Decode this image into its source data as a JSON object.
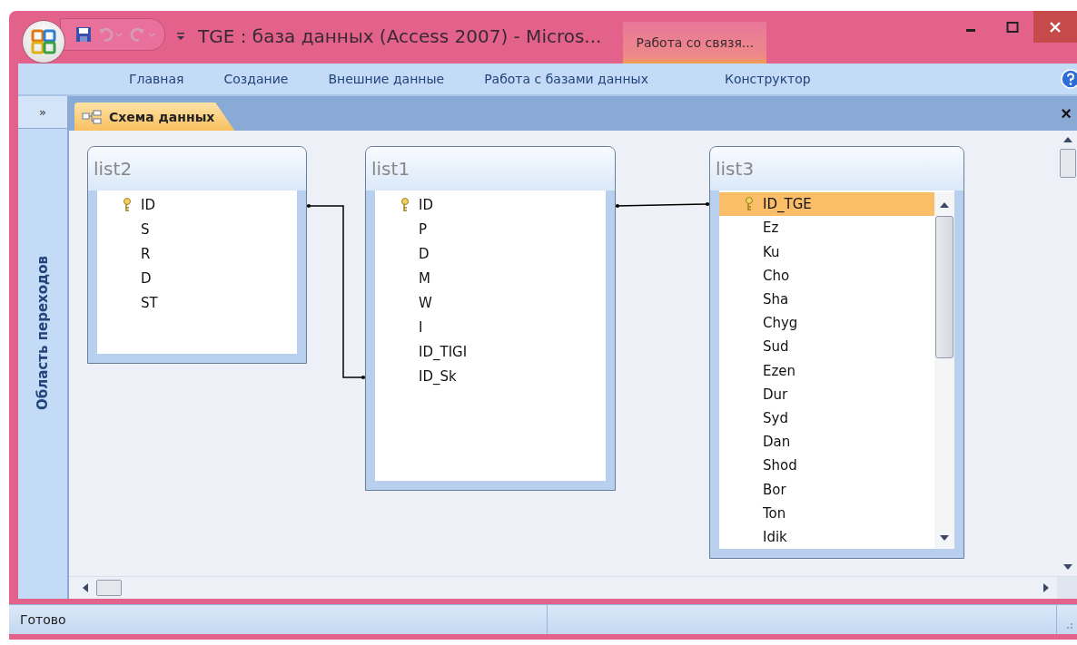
{
  "window": {
    "title": "TGE : база данных (Access 2007) - Micros...",
    "context_tab": "Работа со связя..."
  },
  "ribbon_tabs": [
    {
      "label": "Главная"
    },
    {
      "label": "Создание"
    },
    {
      "label": "Внешние данные"
    },
    {
      "label": "Работа с базами данных"
    },
    {
      "label": "Конструктор"
    }
  ],
  "navigation_pane": {
    "toggle": "»",
    "label": "Область переходов"
  },
  "document_tab": {
    "label": "Схема данных",
    "selected": true,
    "close": "×"
  },
  "tables": [
    {
      "name": "list2",
      "fields": [
        {
          "name": "ID",
          "key": true,
          "selected": false
        },
        {
          "name": "S",
          "key": false,
          "selected": false
        },
        {
          "name": "R",
          "key": false,
          "selected": false
        },
        {
          "name": "D",
          "key": false,
          "selected": false
        },
        {
          "name": "ST",
          "key": false,
          "selected": false
        }
      ],
      "scrollbar": false
    },
    {
      "name": "list1",
      "fields": [
        {
          "name": "ID",
          "key": true,
          "selected": false
        },
        {
          "name": "P",
          "key": false,
          "selected": false
        },
        {
          "name": "D",
          "key": false,
          "selected": false
        },
        {
          "name": "M",
          "key": false,
          "selected": false
        },
        {
          "name": "W",
          "key": false,
          "selected": false
        },
        {
          "name": "I",
          "key": false,
          "selected": false
        },
        {
          "name": "ID_TIGI",
          "key": false,
          "selected": false
        },
        {
          "name": "ID_Sk",
          "key": false,
          "selected": false
        }
      ],
      "scrollbar": false
    },
    {
      "name": "list3",
      "fields": [
        {
          "name": "ID_TGE",
          "key": true,
          "selected": true
        },
        {
          "name": "Ez",
          "key": false,
          "selected": false
        },
        {
          "name": "Ku",
          "key": false,
          "selected": false
        },
        {
          "name": "Cho",
          "key": false,
          "selected": false
        },
        {
          "name": "Sha",
          "key": false,
          "selected": false
        },
        {
          "name": "Chyg",
          "key": false,
          "selected": false
        },
        {
          "name": "Sud",
          "key": false,
          "selected": false
        },
        {
          "name": "Ezen",
          "key": false,
          "selected": false
        },
        {
          "name": "Dur",
          "key": false,
          "selected": false
        },
        {
          "name": "Syd",
          "key": false,
          "selected": false
        },
        {
          "name": "Dan",
          "key": false,
          "selected": false
        },
        {
          "name": "Shod",
          "key": false,
          "selected": false
        },
        {
          "name": "Bor",
          "key": false,
          "selected": false
        },
        {
          "name": "Ton",
          "key": false,
          "selected": false
        },
        {
          "name": "Idik",
          "key": false,
          "selected": false
        }
      ],
      "scrollbar": true
    }
  ],
  "status_bar": {
    "text": "Готово"
  }
}
